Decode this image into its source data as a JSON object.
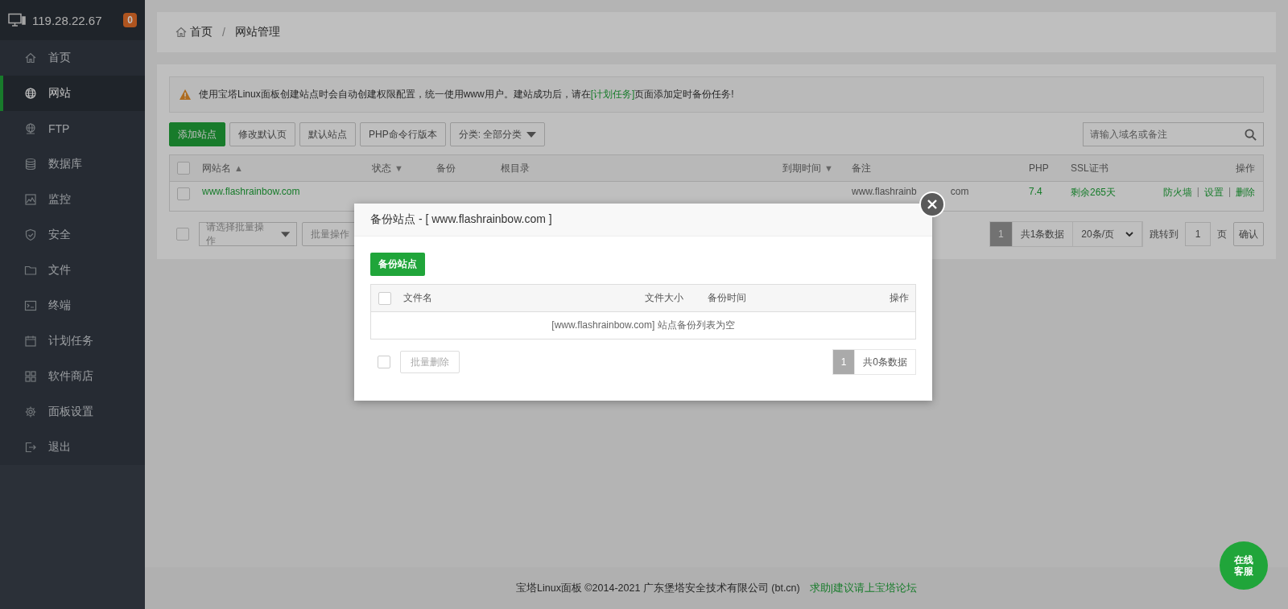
{
  "server": {
    "ip": "119.28.22.67",
    "badge": "0"
  },
  "sidebar": {
    "items": [
      {
        "label": "首页",
        "selected": false
      },
      {
        "label": "网站",
        "selected": true
      },
      {
        "label": "FTP",
        "selected": false
      },
      {
        "label": "数据库",
        "selected": false
      },
      {
        "label": "监控",
        "selected": false
      },
      {
        "label": "安全",
        "selected": false
      },
      {
        "label": "文件",
        "selected": false
      },
      {
        "label": "终端",
        "selected": false
      },
      {
        "label": "计划任务",
        "selected": false
      },
      {
        "label": "软件商店",
        "selected": false
      },
      {
        "label": "面板设置",
        "selected": false
      },
      {
        "label": "退出",
        "selected": false
      }
    ]
  },
  "breadcrumb": {
    "items": [
      "首页",
      "网站管理"
    ],
    "separator": "/"
  },
  "notice": {
    "before": "使用宝塔Linux面板创建站点时会自动创建权限配置，统一使用www用户。建站成功后，请在",
    "link": "[计划任务]",
    "after": "页面添加定时备份任务!"
  },
  "toolbar": {
    "buttons": [
      {
        "label": "添加站点",
        "kind": "primary"
      },
      {
        "label": "修改默认页",
        "kind": "default"
      },
      {
        "label": "默认站点",
        "kind": "default"
      },
      {
        "label": "PHP命令行版本",
        "kind": "default"
      }
    ],
    "category": "分类: 全部分类",
    "search_placeholder": "请输入域名或备注"
  },
  "table": {
    "select_all_checked": false,
    "columns": [
      {
        "label": "网站名",
        "sort_mark": "▲"
      },
      {
        "label": "状态",
        "sort_mark": "▼"
      },
      {
        "label": "备份"
      },
      {
        "label": "根目录"
      },
      {
        "label": "到期时间",
        "sort_mark": "▼"
      },
      {
        "label": "备注"
      },
      {
        "label": "PHP"
      },
      {
        "label": "SSL证书"
      },
      {
        "label": "操作"
      }
    ],
    "rows": [
      {
        "checked": false,
        "name": "www.flashrainbow.com",
        "remark_start": "www.flashrainb",
        "remark_end": "com",
        "php": "7.4",
        "ssl": "剩余265天",
        "actions": [
          "防火墙",
          "设置",
          "删除"
        ],
        "action_separator": "|"
      }
    ]
  },
  "batch": {
    "checked": false,
    "placeholder": "请选择批量操作",
    "button": "批量操作"
  },
  "pagination": {
    "current": "1",
    "total": "共1条数据",
    "per_page": "20条/页",
    "jump_label": "跳转到",
    "jump_value": "1",
    "unit": "页",
    "confirm": "确认"
  },
  "modal": {
    "header_checked": false,
    "footer_checked": false,
    "title": "备份站点 - [ www.flashrainbow.com ]",
    "backup_button": "备份站点",
    "columns": [
      {
        "label": "文件名"
      },
      {
        "label": "文件大小"
      },
      {
        "label": "备份时间"
      },
      {
        "label": "操作"
      }
    ],
    "empty": "[www.flashrainbow.com] 站点备份列表为空",
    "batch_delete": "批量删除",
    "current": "1",
    "total": "共0条数据"
  },
  "footer": {
    "copyright": "宝塔Linux面板 ©2014-2021 广东堡塔安全技术有限公司 (bt.cn)",
    "link": "求助|建议请上宝塔论坛"
  },
  "chat": [
    "在线",
    "客服"
  ]
}
